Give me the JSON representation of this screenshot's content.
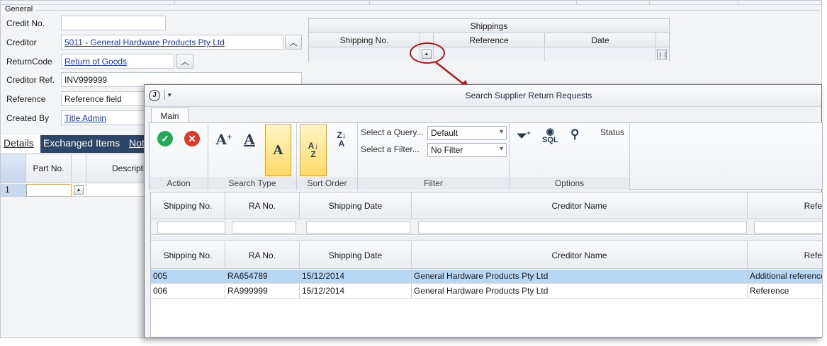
{
  "form": {
    "group_title": "General",
    "fields": [
      {
        "label": "Credit No.",
        "value": ""
      },
      {
        "label": "Creditor",
        "value": "5011 - General Hardware Products Pty Ltd"
      },
      {
        "label": "ReturnCode",
        "value": "Return of Goods"
      },
      {
        "label": "Creditor Ref.",
        "value": "INV999999"
      },
      {
        "label": "Reference",
        "value": "Reference field"
      },
      {
        "label": "Created By",
        "value": "Title Admin"
      }
    ]
  },
  "shippings": {
    "title": "Shippings",
    "columns": [
      "Shipping No.",
      "Reference",
      "Date"
    ]
  },
  "tabs": [
    "Details",
    "Exchanged Items",
    "Not"
  ],
  "details_grid": {
    "columns": [
      "Part No.",
      "Description"
    ],
    "row_number": "1"
  },
  "dialog": {
    "title": "Search Supplier Return Requests",
    "ribbon_tab": "Main",
    "groups": {
      "action": "Action",
      "search_type": "Search Type",
      "sort_order": "Sort Order",
      "filter": "Filter",
      "options": "Options"
    },
    "filter": {
      "query_label": "Select a Query...",
      "query_value": "Default",
      "filter_label": "Select a Filter...",
      "filter_value": "No Filter"
    },
    "options": {
      "sql_label": "SQL",
      "status_label": "Status"
    },
    "columns": [
      "Shipping No.",
      "RA No.",
      "Shipping Date",
      "Creditor Name",
      "Refe"
    ],
    "columns_lower_last": "Refe",
    "rows": [
      [
        "005",
        "RA654789",
        "15/12/2014",
        "General Hardware Products Pty Ltd",
        "Additional reference"
      ],
      [
        "006",
        "RA999999",
        "15/12/2014",
        "General Hardware Products Pty Ltd",
        "Reference"
      ]
    ]
  },
  "colors": {
    "tab_bar": "#2b4668",
    "selection": "#b8d7f5",
    "callout": "#b2191e",
    "link": "#1b36c2"
  }
}
